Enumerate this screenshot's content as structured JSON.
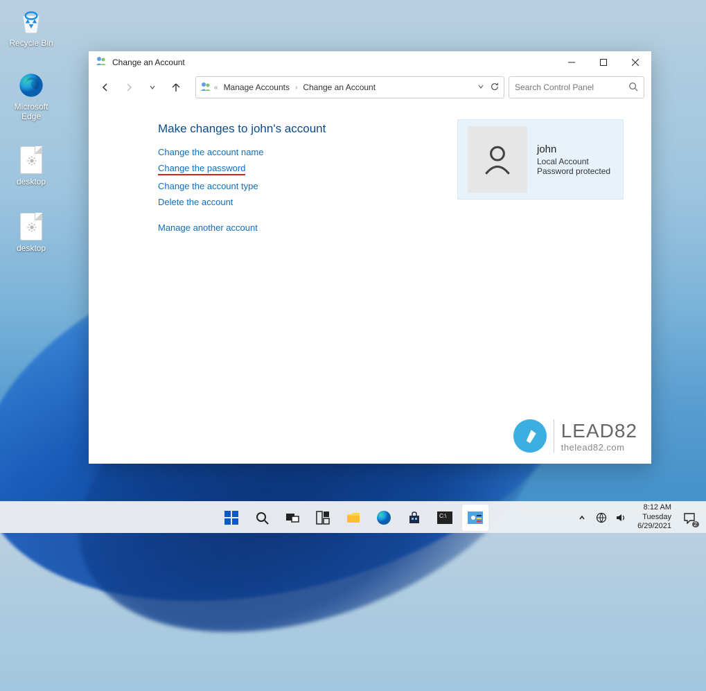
{
  "desktop": {
    "icons": [
      {
        "label": "Recycle Bin"
      },
      {
        "label": "Microsoft Edge"
      },
      {
        "label": "desktop"
      },
      {
        "label": "desktop"
      }
    ]
  },
  "window": {
    "title": "Change an Account",
    "breadcrumbs": {
      "prefix": "«",
      "items": [
        "Manage Accounts",
        "Change an Account"
      ]
    },
    "search": {
      "placeholder": "Search Control Panel"
    },
    "heading": "Make changes to john's account",
    "actions": {
      "change_name": "Change the account name",
      "change_password": "Change the password",
      "change_type": "Change the account type",
      "delete": "Delete the account",
      "manage_another": "Manage another account"
    },
    "account": {
      "username": "john",
      "type": "Local Account",
      "protection": "Password protected"
    },
    "watermark": {
      "brand": "LEAD82",
      "url": "thelead82.com"
    }
  },
  "taskbar": {
    "datetime": {
      "time": "8:12 AM",
      "day": "Tuesday",
      "date": "6/29/2021"
    },
    "notif_count": "2"
  }
}
